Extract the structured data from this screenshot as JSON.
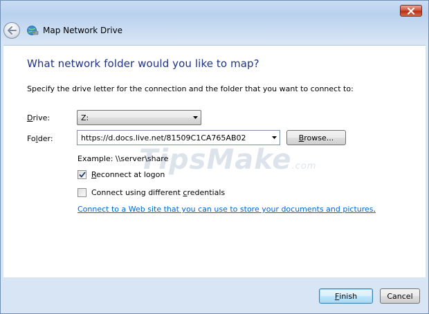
{
  "window": {
    "title": "Map Network Drive",
    "close_icon": "close-icon",
    "back_icon": "back-arrow-icon",
    "app_icon": "network-drive-icon"
  },
  "main": {
    "heading": "What network folder would you like to map?",
    "instruction": "Specify the drive letter for the connection and the folder that you want to connect to:",
    "drive_label_accel": "D",
    "drive_label_rest": "rive:",
    "drive_value": "Z:",
    "folder_label_first": "Fo",
    "folder_label_accel": "l",
    "folder_label_rest": "der:",
    "folder_value": "https://d.docs.live.net/81509C1CA765AB02",
    "browse_accel": "B",
    "browse_rest": "rowse...",
    "example": "Example: \\\\server\\share",
    "reconnect_accel": "R",
    "reconnect_rest": "econnect at logon",
    "reconnect_checked": true,
    "credentials_first": "Connect using different ",
    "credentials_accel": "c",
    "credentials_rest": "redentials",
    "credentials_checked": false,
    "web_link": "Connect to a Web site that you can use to store your documents and pictures",
    "web_link_suffix": "."
  },
  "footer": {
    "finish_accel": "F",
    "finish_rest": "inish",
    "cancel_label": "Cancel"
  },
  "watermark": {
    "text": "TipsMake",
    "suffix": ".com"
  },
  "colors": {
    "heading": "#1e3287",
    "link": "#0066cc",
    "titlebar": "#c9dcf2"
  }
}
